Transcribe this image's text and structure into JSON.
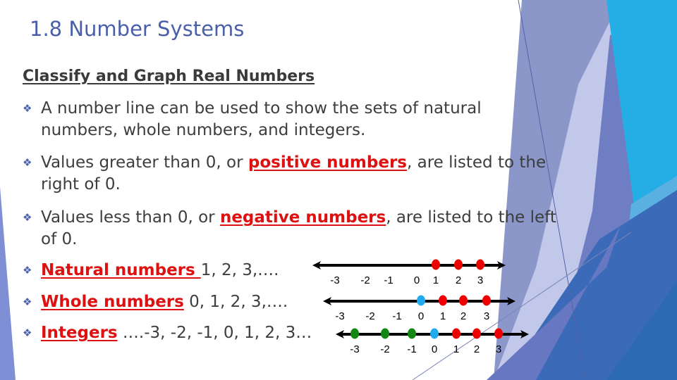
{
  "slide": {
    "title": "1.8 Number Systems",
    "subtitle": "Classify and Graph Real Numbers",
    "bullet_glyph": "diamond-cluster-icon",
    "bullets": [
      {
        "text": "A number line can be used to show the sets of natural numbers, whole numbers, and integers."
      },
      {
        "pre": "Values greater than 0, or ",
        "highlight": "positive numbers",
        "post": ", are listed to the right of 0."
      },
      {
        "pre": "Values less than 0, or ",
        "highlight": "negative numbers",
        "post": ", are listed to the left of 0."
      },
      {
        "highlight": "Natural numbers ",
        "post": "1, 2, 3,…."
      },
      {
        "highlight": "Whole numbers",
        "post": " 0, 1, 2, 3,…."
      },
      {
        "highlight": "Integers",
        "post": " ….-3, -2, -1, 0, 1, 2, 3…"
      }
    ]
  },
  "number_lines": [
    {
      "name": "natural",
      "labels": [
        "-3",
        "-2",
        "-1",
        "0",
        "1",
        "2",
        "3"
      ],
      "points": [
        1,
        2,
        3
      ],
      "point_colors": {
        "1": "#ee0000",
        "2": "#ee0000",
        "3": "#ee0000"
      }
    },
    {
      "name": "whole",
      "labels": [
        "-3",
        "-2",
        "-1",
        "0",
        "1",
        "2",
        "3"
      ],
      "points": [
        0,
        1,
        2,
        3
      ],
      "point_colors": {
        "0": "#22aaee",
        "1": "#ee0000",
        "2": "#ee0000",
        "3": "#ee0000"
      }
    },
    {
      "name": "integers",
      "labels": [
        "-3",
        "-2",
        "-1",
        "0",
        "1",
        "2",
        "3"
      ],
      "points": [
        -3,
        -2,
        -1,
        0,
        1,
        2,
        3
      ],
      "point_colors": {
        "-3": "#118811",
        "-2": "#118811",
        "-1": "#118811",
        "0": "#22aaee",
        "1": "#ee0000",
        "2": "#ee0000",
        "3": "#ee0000"
      }
    }
  ],
  "colors": {
    "title": "#4a5fa9",
    "highlight": "#dd1111",
    "positive": "#ee0000",
    "zero": "#22aaee",
    "negative": "#118811"
  }
}
